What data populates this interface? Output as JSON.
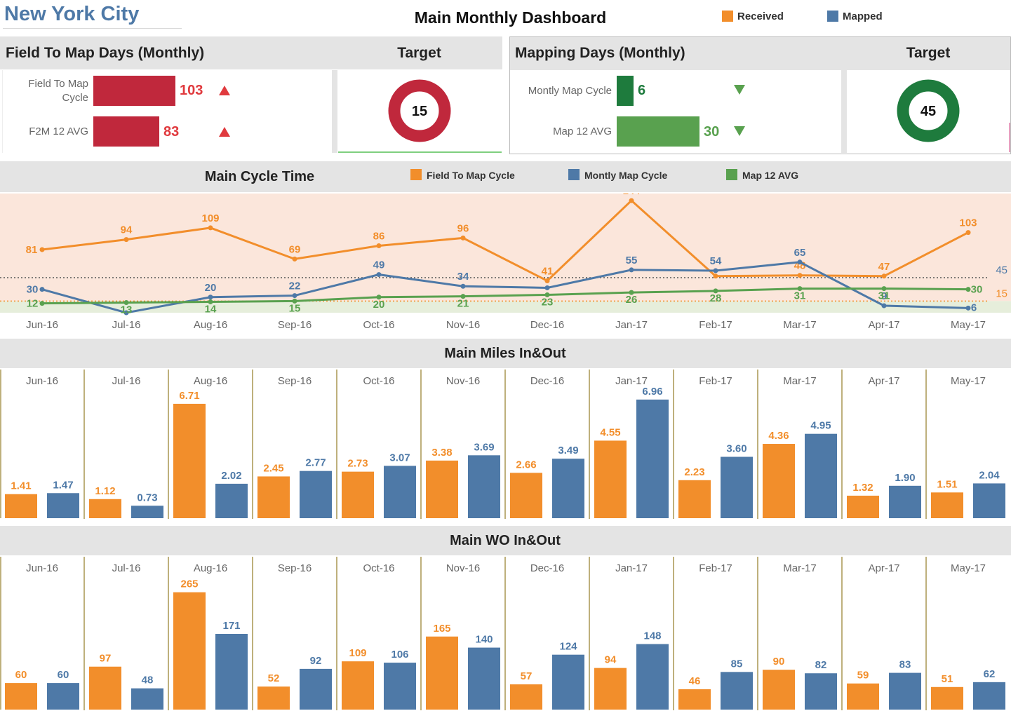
{
  "header": {
    "city": "New York City",
    "title": "Main Monthly Dashboard",
    "legend": [
      {
        "label": "Received",
        "color": "#f28e2b"
      },
      {
        "label": "Mapped",
        "color": "#4e79a7"
      }
    ]
  },
  "field_panel": {
    "title": "Field To Map Days (Monthly)",
    "target_title": "Target",
    "target_value": "15",
    "target_color": "#c0283c",
    "rows": [
      {
        "label_line1": "Field To Map",
        "label_line2": "Cycle",
        "value": 103,
        "value_text": "103",
        "color": "#c0283c",
        "trend": "up"
      },
      {
        "label_line1": "F2M 12 AVG",
        "label_line2": "",
        "value": 83,
        "value_text": "83",
        "color": "#c0283c",
        "trend": "up"
      }
    ],
    "bar_max": 103
  },
  "mapping_panel": {
    "title": "Mapping Days (Monthly)",
    "target_title": "Target",
    "target_value": "45",
    "target_color": "#1e7b3d",
    "rows": [
      {
        "label_line1": "Montly Map Cycle",
        "label_line2": "",
        "value": 6,
        "value_text": "6",
        "color": "#1e7b3d",
        "trend": "down"
      },
      {
        "label_line1": "Map 12 AVG",
        "label_line2": "",
        "value": 30,
        "value_text": "30",
        "color": "#59a14f",
        "trend": "down"
      }
    ],
    "bar_max": 30
  },
  "cycle_section": {
    "title": "Main Cycle Time",
    "legend": [
      {
        "label": "Field To Map Cycle",
        "color": "#f28e2b"
      },
      {
        "label": "Montly Map Cycle",
        "color": "#4e79a7"
      },
      {
        "label": "Map 12 AVG",
        "color": "#59a14f"
      }
    ],
    "ref_lines": [
      {
        "value": 45,
        "label": "45",
        "color": "#4e79a7"
      },
      {
        "value": 15,
        "label": "15",
        "color": "#f28e2b"
      }
    ]
  },
  "miles_section": {
    "title": "Main Miles In&Out"
  },
  "wo_section": {
    "title": "Main WO In&Out"
  },
  "chart_data": [
    {
      "type": "line",
      "title": "Main Cycle Time",
      "categories": [
        "Jun-16",
        "Jul-16",
        "Aug-16",
        "Sep-16",
        "Oct-16",
        "Nov-16",
        "Dec-16",
        "Jan-17",
        "Feb-17",
        "Mar-17",
        "Apr-17",
        "May-17"
      ],
      "series": [
        {
          "name": "Field To Map Cycle",
          "color": "#f28e2b",
          "values": [
            81,
            94,
            109,
            69,
            86,
            96,
            41,
            144,
            null,
            48,
            47,
            103
          ]
        },
        {
          "name": "Montly Map Cycle",
          "color": "#4e79a7",
          "values": [
            30,
            null,
            20,
            22,
            49,
            34,
            null,
            55,
            54,
            65,
            9,
            6
          ]
        },
        {
          "name": "Map 12 AVG",
          "color": "#59a14f",
          "values": [
            12,
            13,
            14,
            15,
            20,
            21,
            23,
            26,
            28,
            31,
            31,
            30
          ]
        }
      ],
      "ylim": [
        0,
        150
      ],
      "reference_lines": [
        45,
        15
      ]
    },
    {
      "type": "bar",
      "title": "Main Miles In&Out",
      "categories": [
        "Jun-16",
        "Jul-16",
        "Aug-16",
        "Sep-16",
        "Oct-16",
        "Nov-16",
        "Dec-16",
        "Jan-17",
        "Feb-17",
        "Mar-17",
        "Apr-17",
        "May-17"
      ],
      "series": [
        {
          "name": "Received",
          "color": "#f28e2b",
          "values": [
            1.41,
            1.12,
            6.71,
            2.45,
            2.73,
            3.38,
            2.66,
            4.55,
            2.23,
            4.36,
            1.32,
            1.51
          ]
        },
        {
          "name": "Mapped",
          "color": "#4e79a7",
          "values": [
            1.47,
            0.73,
            2.02,
            2.77,
            3.07,
            3.69,
            3.49,
            6.96,
            3.6,
            4.95,
            1.9,
            2.04
          ]
        }
      ],
      "value_labels": {
        "Received": [
          "1.41",
          "1.12",
          "6.71",
          "2.45",
          "2.73",
          "3.38",
          "2.66",
          "4.55",
          "2.23",
          "4.36",
          "1.32",
          "1.51"
        ],
        "Mapped": [
          "1.47",
          "0.73",
          "2.02",
          "2.77",
          "3.07",
          "3.69",
          "3.49",
          "6.96",
          "3.60",
          "4.95",
          "1.90",
          "2.04"
        ]
      },
      "ymax": 7.2
    },
    {
      "type": "bar",
      "title": "Main WO In&Out",
      "categories": [
        "Jun-16",
        "Jul-16",
        "Aug-16",
        "Sep-16",
        "Oct-16",
        "Nov-16",
        "Dec-16",
        "Jan-17",
        "Feb-17",
        "Mar-17",
        "Apr-17",
        "May-17"
      ],
      "series": [
        {
          "name": "Received",
          "color": "#f28e2b",
          "values": [
            60,
            97,
            265,
            52,
            109,
            165,
            57,
            94,
            46,
            90,
            59,
            51
          ]
        },
        {
          "name": "Mapped",
          "color": "#4e79a7",
          "values": [
            60,
            48,
            171,
            92,
            106,
            140,
            124,
            148,
            85,
            82,
            83,
            62
          ]
        }
      ],
      "value_labels": {
        "Received": [
          "60",
          "97",
          "265",
          "52",
          "109",
          "165",
          "57",
          "94",
          "46",
          "90",
          "59",
          "51"
        ],
        "Mapped": [
          "60",
          "48",
          "171",
          "92",
          "106",
          "140",
          "124",
          "148",
          "85",
          "82",
          "83",
          "62"
        ]
      },
      "ymax": 285
    }
  ]
}
